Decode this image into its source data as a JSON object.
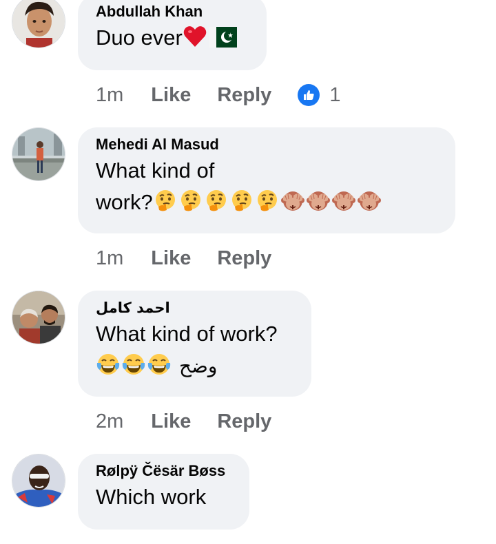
{
  "comments": [
    {
      "author": "Abdullah Khan",
      "text": "Duo ever",
      "emojis": [
        "red-heart",
        "pakistan-flag"
      ],
      "time": "1m",
      "like_label": "Like",
      "reply_label": "Reply",
      "reaction_count": "1",
      "reaction_type": "like"
    },
    {
      "author": "Mehedi Al Masud",
      "text_line1": "What kind of",
      "text_line2": "work?",
      "emojis": [
        "thinking-face",
        "thinking-face",
        "thinking-face",
        "thinking-face",
        "thinking-face",
        "see-no-evil-monkey",
        "see-no-evil-monkey",
        "see-no-evil-monkey",
        "see-no-evil-monkey"
      ],
      "time": "1m",
      "like_label": "Like",
      "reply_label": "Reply"
    },
    {
      "author": "احمد كامل",
      "text": "What kind of work?",
      "emojis": [
        "tears-of-joy",
        "tears-of-joy",
        "tears-of-joy"
      ],
      "text_arabic": "وضح",
      "time": "2m",
      "like_label": "Like",
      "reply_label": "Reply"
    },
    {
      "author": "Rølpÿ Čësär Bøss",
      "text": "Which work"
    }
  ],
  "colors": {
    "bubble_bg": "#f0f2f5",
    "meta_text": "#65676b",
    "like_blue": "#1877f2",
    "body_text": "#050505"
  }
}
